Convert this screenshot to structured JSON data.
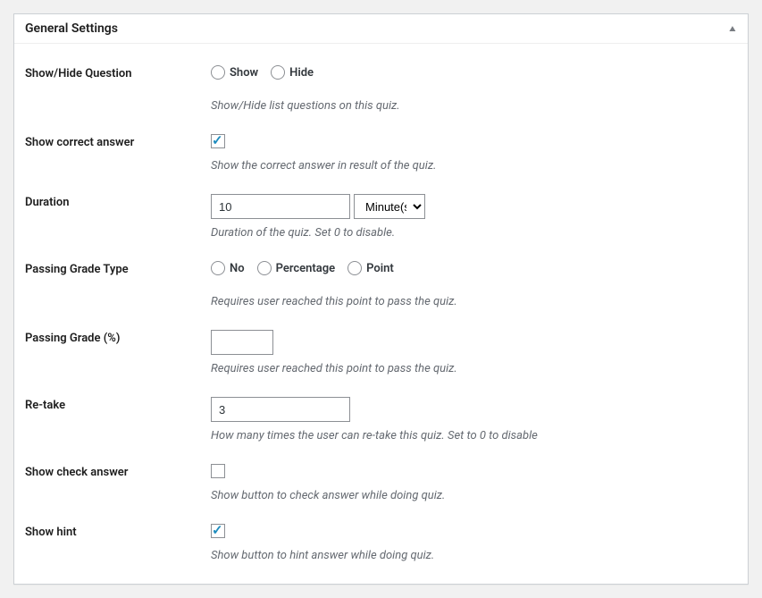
{
  "panel": {
    "title": "General Settings"
  },
  "fields": {
    "show_hide_question": {
      "label": "Show/Hide Question",
      "options": {
        "show": "Show",
        "hide": "Hide"
      },
      "description": "Show/Hide list questions on this quiz."
    },
    "show_correct_answer": {
      "label": "Show correct answer",
      "checked": true,
      "description": "Show the correct answer in result of the quiz."
    },
    "duration": {
      "label": "Duration",
      "value": "10",
      "unit": "Minute(s)",
      "description": "Duration of the quiz. Set 0 to disable."
    },
    "passing_grade_type": {
      "label": "Passing Grade Type",
      "options": {
        "no": "No",
        "percentage": "Percentage",
        "point": "Point"
      },
      "description": "Requires user reached this point to pass the quiz."
    },
    "passing_grade": {
      "label": "Passing Grade (%)",
      "value": "",
      "description": "Requires user reached this point to pass the quiz."
    },
    "retake": {
      "label": "Re-take",
      "value": "3",
      "description": "How many times the user can re-take this quiz. Set to 0 to disable"
    },
    "show_check_answer": {
      "label": "Show check answer",
      "checked": false,
      "description": "Show button to check answer while doing quiz."
    },
    "show_hint": {
      "label": "Show hint",
      "checked": true,
      "description": "Show button to hint answer while doing quiz."
    }
  }
}
